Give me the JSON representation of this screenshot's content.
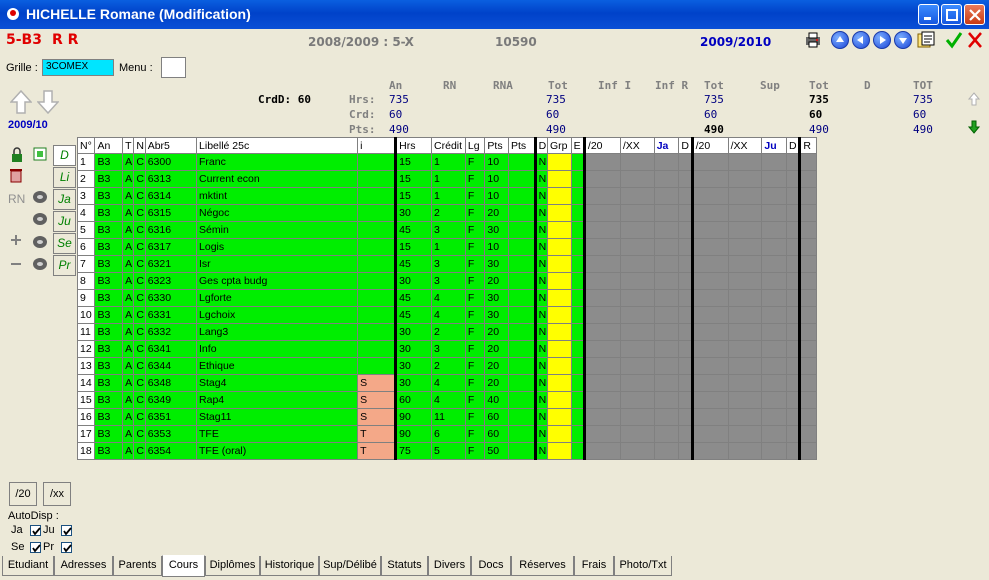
{
  "window": {
    "title": "HICHELLE Romane (Modification)"
  },
  "header": {
    "class_code": "5-B3",
    "initials": "R R",
    "year_section": "2008/2009 : 5-X",
    "id_number": "10590",
    "target_year": "2009/2010"
  },
  "grille": {
    "label": "Grille :",
    "value": "3COMEX"
  },
  "menu": {
    "label": "Menu :"
  },
  "year_label": "2009/10",
  "stats": {
    "headers": [
      "An",
      "RN",
      "RNA",
      "Tot",
      "Inf I",
      "Inf R",
      "Tot",
      "Sup",
      "Tot",
      "D",
      "TOT"
    ],
    "crdd_label": "CrdD: 60",
    "rows": [
      {
        "label": "Hrs:",
        "tot1": "735",
        "tot2": "735",
        "tot3": "735",
        "tot4": "735"
      },
      {
        "label": "Crd:",
        "tot1": "60",
        "tot2": "60",
        "tot3": "60",
        "tot4": "60"
      },
      {
        "label": "Pts:",
        "tot1": "490",
        "tot2": "490",
        "tot3": "490",
        "tot4": "490"
      }
    ]
  },
  "side_tabs": [
    "D",
    "Li",
    "Ja",
    "Ju",
    "Se",
    "Pr"
  ],
  "side_labels": {
    "rn": "RN"
  },
  "grid": {
    "columns": [
      "N°",
      "An",
      "T",
      "N",
      "Abr5",
      "Libellé 25c",
      "i",
      "Hrs",
      "Crédit",
      "Lg",
      "Pts",
      "Pts",
      "D",
      "Grp",
      "E",
      "/20",
      "/XX",
      "Ja",
      "D",
      "/20",
      "/XX",
      "Ju",
      "D",
      "R"
    ],
    "rows": [
      {
        "n": "1",
        "an": "B3",
        "t": "A",
        "nn": "C",
        "abr": "6300",
        "lib": "Franc",
        "i": "",
        "hrs": "15",
        "cr": "1",
        "lg": "F",
        "pts": "10",
        "d": "N"
      },
      {
        "n": "2",
        "an": "B3",
        "t": "A",
        "nn": "C",
        "abr": "6313",
        "lib": "Current econ",
        "i": "",
        "hrs": "15",
        "cr": "1",
        "lg": "F",
        "pts": "10",
        "d": "N"
      },
      {
        "n": "3",
        "an": "B3",
        "t": "A",
        "nn": "C",
        "abr": "6314",
        "lib": "mktint",
        "i": "",
        "hrs": "15",
        "cr": "1",
        "lg": "F",
        "pts": "10",
        "d": "N"
      },
      {
        "n": "4",
        "an": "B3",
        "t": "A",
        "nn": "C",
        "abr": "6315",
        "lib": "Négoc",
        "i": "",
        "hrs": "30",
        "cr": "2",
        "lg": "F",
        "pts": "20",
        "d": "N"
      },
      {
        "n": "5",
        "an": "B3",
        "t": "A",
        "nn": "C",
        "abr": "6316",
        "lib": "Sémin",
        "i": "",
        "hrs": "45",
        "cr": "3",
        "lg": "F",
        "pts": "30",
        "d": "N"
      },
      {
        "n": "6",
        "an": "B3",
        "t": "A",
        "nn": "C",
        "abr": "6317",
        "lib": "Logis",
        "i": "",
        "hrs": "15",
        "cr": "1",
        "lg": "F",
        "pts": "10",
        "d": "N"
      },
      {
        "n": "7",
        "an": "B3",
        "t": "A",
        "nn": "C",
        "abr": "6321",
        "lib": "Isr",
        "i": "",
        "hrs": "45",
        "cr": "3",
        "lg": "F",
        "pts": "30",
        "d": "N"
      },
      {
        "n": "8",
        "an": "B3",
        "t": "A",
        "nn": "C",
        "abr": "6323",
        "lib": "Ges cpta budg",
        "i": "",
        "hrs": "30",
        "cr": "3",
        "lg": "F",
        "pts": "20",
        "d": "N"
      },
      {
        "n": "9",
        "an": "B3",
        "t": "A",
        "nn": "C",
        "abr": "6330",
        "lib": "Lgforte",
        "i": "",
        "hrs": "45",
        "cr": "4",
        "lg": "F",
        "pts": "30",
        "d": "N"
      },
      {
        "n": "10",
        "an": "B3",
        "t": "A",
        "nn": "C",
        "abr": "6331",
        "lib": "Lgchoix",
        "i": "",
        "hrs": "45",
        "cr": "4",
        "lg": "F",
        "pts": "30",
        "d": "N"
      },
      {
        "n": "11",
        "an": "B3",
        "t": "A",
        "nn": "C",
        "abr": "6332",
        "lib": "Lang3",
        "i": "",
        "hrs": "30",
        "cr": "2",
        "lg": "F",
        "pts": "20",
        "d": "N"
      },
      {
        "n": "12",
        "an": "B3",
        "t": "A",
        "nn": "C",
        "abr": "6341",
        "lib": "Info",
        "i": "",
        "hrs": "30",
        "cr": "3",
        "lg": "F",
        "pts": "20",
        "d": "N"
      },
      {
        "n": "13",
        "an": "B3",
        "t": "A",
        "nn": "C",
        "abr": "6344",
        "lib": "Ethique",
        "i": "",
        "hrs": "30",
        "cr": "2",
        "lg": "F",
        "pts": "20",
        "d": "N"
      },
      {
        "n": "14",
        "an": "B3",
        "t": "A",
        "nn": "C",
        "abr": "6348",
        "lib": "Stag4",
        "i": "S",
        "hrs": "30",
        "cr": "4",
        "lg": "F",
        "pts": "20",
        "d": "N"
      },
      {
        "n": "15",
        "an": "B3",
        "t": "A",
        "nn": "C",
        "abr": "6349",
        "lib": "Rap4",
        "i": "S",
        "hrs": "60",
        "cr": "4",
        "lg": "F",
        "pts": "40",
        "d": "N"
      },
      {
        "n": "16",
        "an": "B3",
        "t": "A",
        "nn": "C",
        "abr": "6351",
        "lib": "Stag11",
        "i": "S",
        "hrs": "90",
        "cr": "11",
        "lg": "F",
        "pts": "60",
        "d": "N"
      },
      {
        "n": "17",
        "an": "B3",
        "t": "A",
        "nn": "C",
        "abr": "6353",
        "lib": "TFE",
        "i": "T",
        "hrs": "90",
        "cr": "6",
        "lg": "F",
        "pts": "60",
        "d": "N"
      },
      {
        "n": "18",
        "an": "B3",
        "t": "A",
        "nn": "C",
        "abr": "6354",
        "lib": "TFE (oral)",
        "i": "T",
        "hrs": "75",
        "cr": "5",
        "lg": "F",
        "pts": "50",
        "d": "N"
      }
    ]
  },
  "buttons": {
    "b20": "/20",
    "bxx": "/xx"
  },
  "autodisp": {
    "label": "AutoDisp :",
    "items": [
      "Ja",
      "Ju",
      "Se",
      "Pr"
    ]
  },
  "bottom_tabs": [
    "Etudiant",
    "Adresses",
    "Parents",
    "Cours",
    "Diplômes",
    "Historique",
    "Sup/Délibé",
    "Statuts",
    "Divers",
    "Docs",
    "Réserves",
    "Frais",
    "Photo/Txt"
  ],
  "colors": {
    "green": "#00ee00",
    "yellow": "#ffff00",
    "salmon": "#f4a888",
    "grey": "#8c8c8c",
    "title_blue": "#0042c9"
  }
}
